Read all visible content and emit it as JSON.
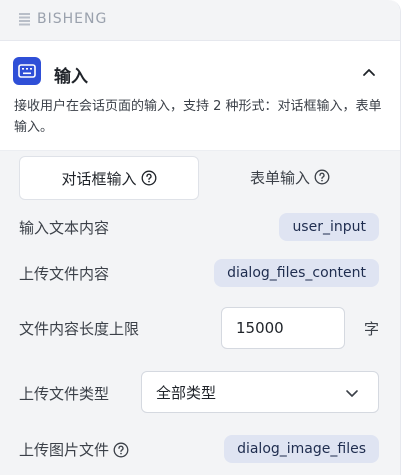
{
  "topbar": {
    "brand": "BISHENG"
  },
  "node": {
    "title": "输入",
    "description": "接收用户在会话页面的输入，支持 2 种形式：对话框输入，表单输入。"
  },
  "tabs": [
    {
      "label": "对话框输入",
      "active": true
    },
    {
      "label": "表单输入",
      "active": false
    }
  ],
  "fields": {
    "text_input": {
      "label": "输入文本内容",
      "value": "user_input"
    },
    "file_content": {
      "label": "上传文件内容",
      "value": "dialog_files_content"
    },
    "max_length": {
      "label": "文件内容长度上限",
      "value": "15000",
      "unit": "字"
    },
    "file_type": {
      "label": "上传文件类型",
      "selected": "全部类型"
    },
    "image_files": {
      "label": "上传图片文件",
      "value": "dialog_image_files"
    }
  },
  "colors": {
    "accent": "#2f4fd7",
    "panel_bg": "#f3f4f6",
    "chip_bg": "#dfe4f2"
  },
  "icons": {
    "brand": "bisheng-logo-icon",
    "node": "keyboard-icon",
    "collapse": "chevron-up-icon",
    "help": "question-circle-icon",
    "select": "chevron-down-icon"
  }
}
